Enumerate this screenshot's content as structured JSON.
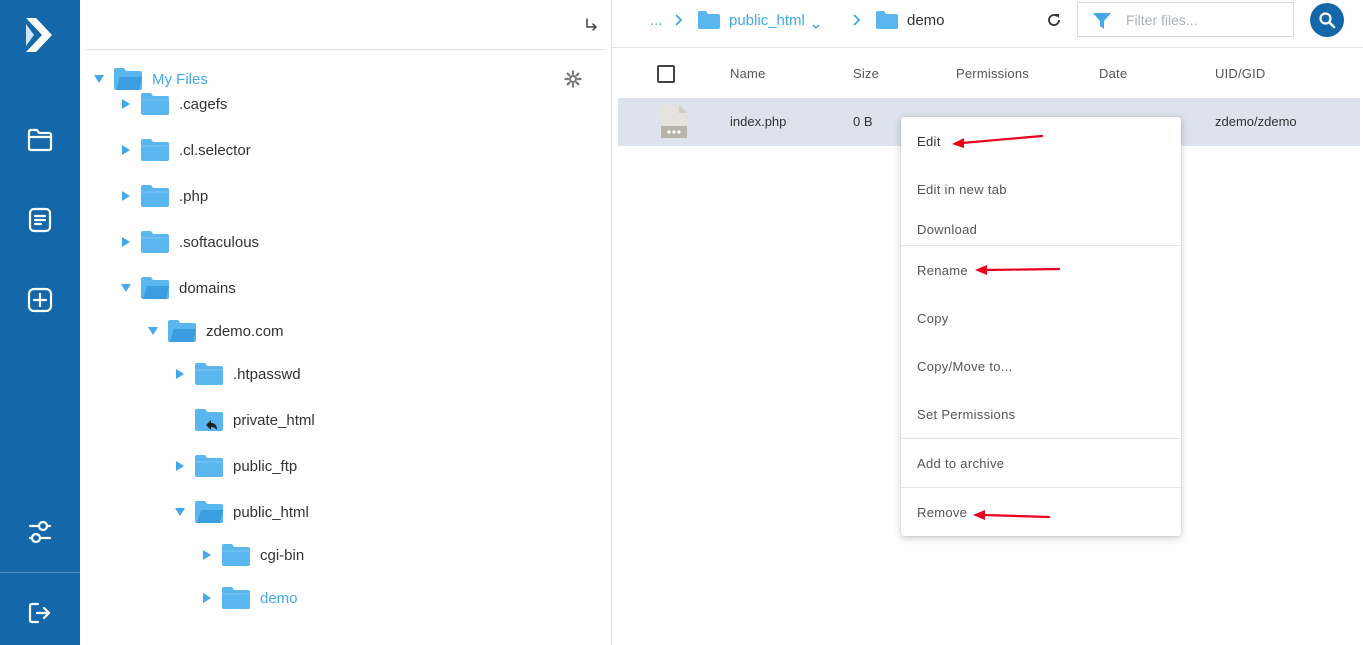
{
  "sidebar": {
    "items": [
      {
        "name": "logo",
        "icon": "logo-icon"
      },
      {
        "name": "file-manager",
        "icon": "folder-icon"
      },
      {
        "name": "notes",
        "icon": "document-icon"
      },
      {
        "name": "add",
        "icon": "plus-square-icon"
      },
      {
        "name": "settings",
        "icon": "sliders-icon"
      },
      {
        "name": "logout",
        "icon": "logout-icon"
      }
    ],
    "color": "#1467a8"
  },
  "tree": {
    "root": "My Files",
    "items": [
      {
        "label": ".cagefs",
        "state": "collapsed"
      },
      {
        "label": ".cl.selector",
        "state": "collapsed"
      },
      {
        "label": ".php",
        "state": "collapsed"
      },
      {
        "label": ".softaculous",
        "state": "collapsed"
      },
      {
        "label": "domains",
        "state": "expanded"
      },
      {
        "label": "zdemo.com",
        "state": "expanded"
      },
      {
        "label": ".htpasswd",
        "state": "collapsed"
      },
      {
        "label": "private_html",
        "state": "link"
      },
      {
        "label": "public_ftp",
        "state": "collapsed"
      },
      {
        "label": "public_html",
        "state": "expanded"
      },
      {
        "label": "cgi-bin",
        "state": "collapsed"
      },
      {
        "label": "demo",
        "state": "collapsed",
        "active": true
      }
    ]
  },
  "breadcrumb": {
    "ellipsis": "...",
    "parent": "public_html",
    "current": "demo"
  },
  "filter": {
    "placeholder": "Filter files..."
  },
  "table": {
    "columns": [
      "Name",
      "Size",
      "Permissions",
      "Date",
      "UID/GID"
    ],
    "rows": [
      {
        "name": "index.php",
        "size": "0 B",
        "uid_gid": "zdemo/zdemo"
      }
    ]
  },
  "context_menu": {
    "items": [
      "Edit",
      "Edit in new tab",
      "Download",
      "Rename",
      "Copy",
      "Copy/Move to...",
      "Set Permissions",
      "Add to archive",
      "Remove"
    ]
  },
  "colors": {
    "accent": "#43a9e8",
    "folder": "#5ab6ee",
    "row_selected": "#dce3ec",
    "annotation_arrow": "#e8001c"
  }
}
